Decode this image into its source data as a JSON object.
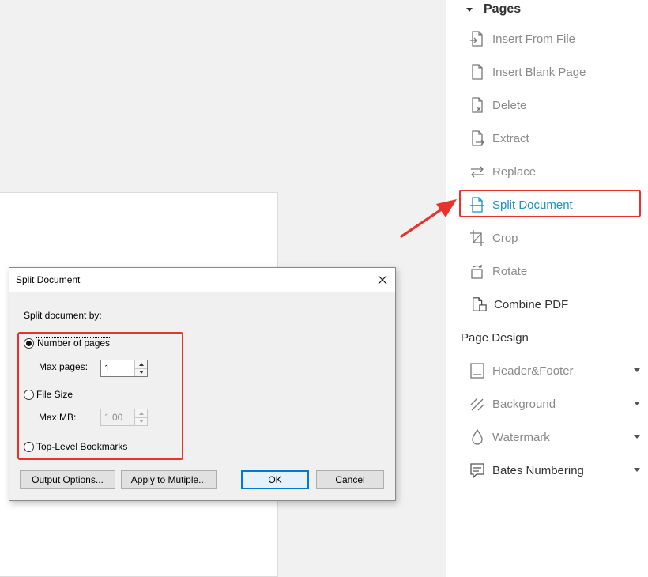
{
  "pages_panel": {
    "section_title": "Pages",
    "tools": [
      {
        "label": "Insert From File",
        "icon": "insert-from-file-icon"
      },
      {
        "label": "Insert Blank Page",
        "icon": "blank-page-icon"
      },
      {
        "label": "Delete",
        "icon": "delete-page-icon"
      },
      {
        "label": "Extract",
        "icon": "extract-page-icon"
      },
      {
        "label": "Replace",
        "icon": "replace-icon"
      },
      {
        "label": "Split Document",
        "icon": "split-document-icon",
        "active": true
      },
      {
        "label": "Crop",
        "icon": "crop-icon"
      },
      {
        "label": "Rotate",
        "icon": "rotate-icon"
      },
      {
        "label": "Combine PDF",
        "icon": "combine-pdf-icon"
      }
    ]
  },
  "page_design": {
    "section_title": "Page Design",
    "tools": [
      {
        "label": "Header&Footer",
        "icon": "header-footer-icon"
      },
      {
        "label": "Background",
        "icon": "background-icon"
      },
      {
        "label": "Watermark",
        "icon": "watermark-icon"
      },
      {
        "label": "Bates Numbering",
        "icon": "bates-numbering-icon"
      }
    ]
  },
  "dialog": {
    "title": "Split Document",
    "split_by_label": "Split document by:",
    "options": {
      "number_of_pages": "Number of pages",
      "file_size": "File Size",
      "bookmarks": "Top-Level Bookmarks"
    },
    "selected_option": "number_of_pages",
    "max_pages_label": "Max pages:",
    "max_pages_value": "1",
    "max_mb_label": "Max MB:",
    "max_mb_value": "1.00",
    "buttons": {
      "output_options": "Output Options...",
      "apply_multiple": "Apply to Mutiple...",
      "ok": "OK",
      "cancel": "Cancel"
    }
  },
  "colors": {
    "highlight_red": "#e8322c",
    "active_blue": "#1a8fd1",
    "muted_gray": "#8a8a8a"
  }
}
